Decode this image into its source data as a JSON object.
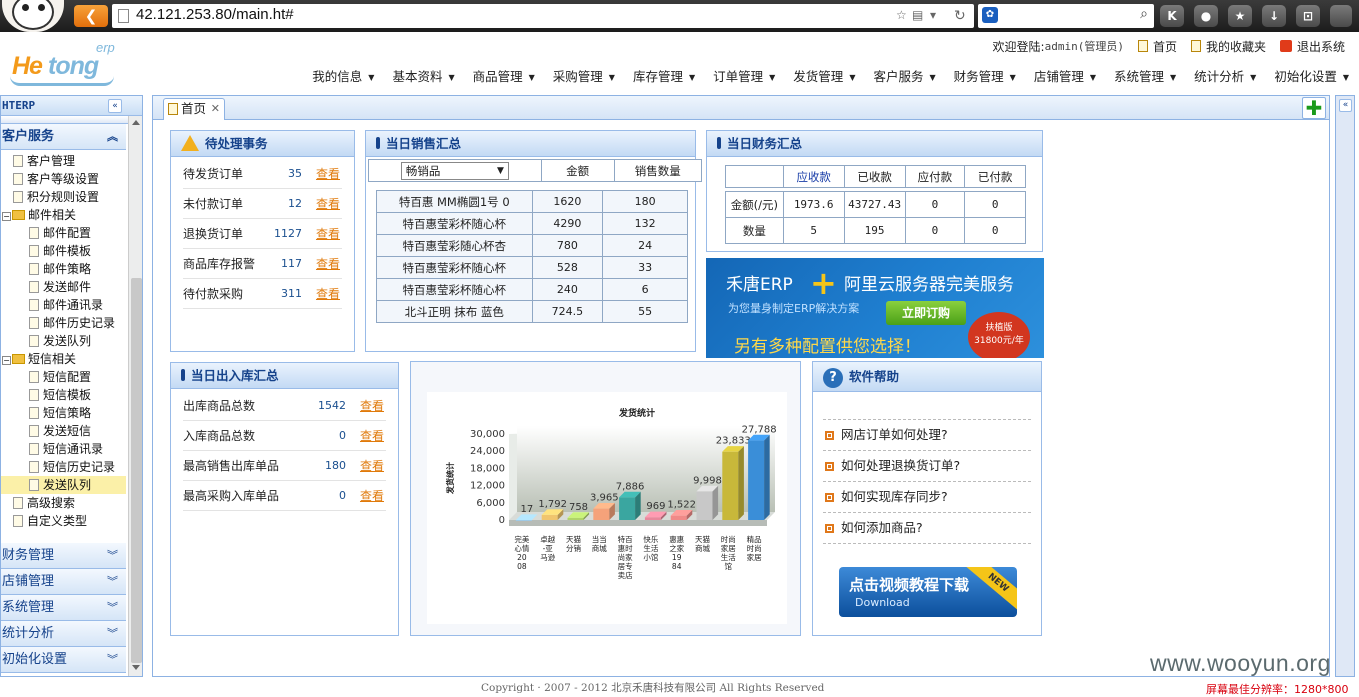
{
  "browser": {
    "url": "42.121.253.80/main.ht#",
    "ext_buttons": [
      "K",
      "●",
      "★",
      "↓",
      "⊡"
    ]
  },
  "header": {
    "logo": {
      "part1": "He",
      "part2": "tong",
      "erp": "erp"
    },
    "welcome": "欢迎登陆:",
    "user": "admin(管理员)",
    "home": "首页",
    "favorites": "我的收藏夹",
    "logout": "退出系统",
    "menu": [
      "我的信息",
      "基本资料",
      "商品管理",
      "采购管理",
      "库存管理",
      "订单管理",
      "发货管理",
      "客户服务",
      "财务管理",
      "店铺管理",
      "系统管理",
      "统计分析",
      "初始化设置"
    ]
  },
  "sidebar": {
    "title": "HTERP",
    "active_section": "客户服务",
    "tree": [
      {
        "label": "客户管理",
        "type": "leaf",
        "level": 0
      },
      {
        "label": "客户等级设置",
        "type": "leaf",
        "level": 0
      },
      {
        "label": "积分规则设置",
        "type": "leaf",
        "level": 0
      },
      {
        "label": "邮件相关",
        "type": "folder",
        "level": 0
      },
      {
        "label": "邮件配置",
        "type": "leaf",
        "level": 1
      },
      {
        "label": "邮件模板",
        "type": "leaf",
        "level": 1
      },
      {
        "label": "邮件策略",
        "type": "leaf",
        "level": 1
      },
      {
        "label": "发送邮件",
        "type": "leaf",
        "level": 1
      },
      {
        "label": "邮件通讯录",
        "type": "leaf",
        "level": 1
      },
      {
        "label": "邮件历史记录",
        "type": "leaf",
        "level": 1
      },
      {
        "label": "发送队列",
        "type": "leaf",
        "level": 1
      },
      {
        "label": "短信相关",
        "type": "folder",
        "level": 0
      },
      {
        "label": "短信配置",
        "type": "leaf",
        "level": 1
      },
      {
        "label": "短信模板",
        "type": "leaf",
        "level": 1
      },
      {
        "label": "短信策略",
        "type": "leaf",
        "level": 1
      },
      {
        "label": "发送短信",
        "type": "leaf",
        "level": 1
      },
      {
        "label": "短信通讯录",
        "type": "leaf",
        "level": 1
      },
      {
        "label": "短信历史记录",
        "type": "leaf",
        "level": 1
      },
      {
        "label": "发送队列",
        "type": "leaf",
        "level": 1,
        "selected": true
      },
      {
        "label": "高级搜索",
        "type": "leaf",
        "level": 0
      },
      {
        "label": "自定义类型",
        "type": "leaf",
        "level": 0
      }
    ],
    "sections_bottom": [
      "财务管理",
      "店铺管理",
      "系统管理",
      "统计分析",
      "初始化设置"
    ]
  },
  "tabs": [
    {
      "label": "首页"
    }
  ],
  "pending": {
    "title": "待处理事务",
    "link_text": "查看",
    "rows": [
      {
        "label": "待发货订单",
        "count": "35"
      },
      {
        "label": "未付款订单",
        "count": "12"
      },
      {
        "label": "退换货订单",
        "count": "1127"
      },
      {
        "label": "商品库存报警",
        "count": "117"
      },
      {
        "label": "待付款采购",
        "count": "311"
      }
    ]
  },
  "sales": {
    "title": "当日销售汇总",
    "select_value": "畅销品",
    "headers": [
      "金额",
      "销售数量"
    ],
    "rows": [
      {
        "name": "特百惠 MM椭圆1号 0",
        "amount": "1620",
        "qty": "180"
      },
      {
        "name": "特百惠莹彩杯随心杯",
        "amount": "4290",
        "qty": "132"
      },
      {
        "name": "特百惠莹彩随心杯杏",
        "amount": "780",
        "qty": "24"
      },
      {
        "name": "特百惠莹彩杯随心杯",
        "amount": "528",
        "qty": "33"
      },
      {
        "name": "特百惠莹彩杯随心杯",
        "amount": "240",
        "qty": "6"
      },
      {
        "name": "北斗正明 抹布 蓝色",
        "amount": "724.5",
        "qty": "55"
      }
    ]
  },
  "finance": {
    "title": "当日财务汇总",
    "headers": [
      "应收款",
      "已收款",
      "应付款",
      "已付款"
    ],
    "rows": [
      {
        "label": "金额(/元)",
        "vals": [
          "1973.6",
          "43727.43",
          "0",
          "0"
        ]
      },
      {
        "label": "数量",
        "vals": [
          "5",
          "195",
          "0",
          "0"
        ]
      }
    ]
  },
  "banner": {
    "brand": "禾唐ERP",
    "plus": "+",
    "service": "阿里云服务器完美服务",
    "sub": "为您量身制定ERP解决方案",
    "button": "立即订购",
    "more": "另有多种配置供您选择！",
    "seal_line1": "扶植版",
    "seal_line2": "31800元/年"
  },
  "stock": {
    "title": "当日出入库汇总",
    "link_text": "查看",
    "rows": [
      {
        "label": "出库商品总数",
        "count": "1542"
      },
      {
        "label": "入库商品总数",
        "count": "0"
      },
      {
        "label": "最高销售出库单品",
        "count": "180"
      },
      {
        "label": "最高采购入库单品",
        "count": ""
      }
    ],
    "last_count": "0"
  },
  "chart_data": {
    "type": "bar",
    "title": "发货统计",
    "ylabel": "发货统计",
    "xlabel": "",
    "ylim": [
      0,
      30000
    ],
    "yticks": [
      "30,000",
      "24,000",
      "18,000",
      "12,000",
      "6,000",
      "0"
    ],
    "categories": [
      "完美心情2008",
      "卓越-亚马逊",
      "天猫分销",
      "当当商城",
      "特百惠时尚家居专卖店",
      "快乐生活小馆",
      "惠惠之家1984",
      "天猫商城",
      "时尚家居生活馆",
      "精品时尚家居"
    ],
    "values": [
      17,
      1792,
      758,
      3965,
      7886,
      969,
      1522,
      9998,
      23833,
      27788
    ],
    "value_labels": [
      "17",
      "1,792",
      "758",
      "3,965",
      "7,886",
      "969",
      "1,522",
      "9,998",
      "23,833",
      "27,788"
    ],
    "colors": [
      "#9ecae9",
      "#f0c56e",
      "#b0d36a",
      "#f5a27a",
      "#3aa6a0",
      "#e8889c",
      "#f08a88",
      "#c8c8c8",
      "#c8b83a",
      "#3a8ed8"
    ]
  },
  "help": {
    "title": "软件帮助",
    "items": [
      "网店订单如何处理?",
      "如何处理退换货订单?",
      "如何实现库存同步?",
      "如何添加商品?"
    ],
    "video_title": "点击视频教程下载",
    "video_sub": "Download",
    "badge": "NEW"
  },
  "footer": {
    "copyright": "Copyright · 2007 - 2012 北京禾唐科技有限公司 All Rights Reserved",
    "resolution": "屏幕最佳分辨率：1280*800",
    "watermark": "www.wooyun.org"
  }
}
